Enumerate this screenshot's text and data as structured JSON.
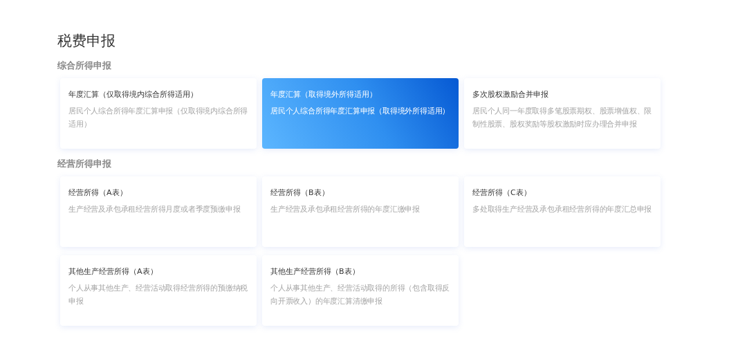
{
  "page_title": "税费申报",
  "sections": [
    {
      "title": "综合所得申报",
      "cards": [
        {
          "title": "年度汇算（仅取得境内综合所得适用）",
          "description": "居民个人综合所得年度汇算申报（仅取得境内综合所得适用）",
          "selected": false
        },
        {
          "title": "年度汇算（取得境外所得适用）",
          "description": "居民个人综合所得年度汇算申报（取得境外所得适用）",
          "selected": true
        },
        {
          "title": "多次股权激励合并申报",
          "description": "居民个人同一年度取得多笔股票期权、股票增值权、限制性股票、股权奖励等股权激励时应办理合并申报",
          "selected": false
        }
      ]
    },
    {
      "title": "经营所得申报",
      "cards": [
        {
          "title": "经营所得（A表）",
          "description": "生产经营及承包承租经营所得月度或者季度预缴申报",
          "selected": false
        },
        {
          "title": "经营所得（B表）",
          "description": "生产经营及承包承租经营所得的年度汇缴申报",
          "selected": false
        },
        {
          "title": "经营所得（C表）",
          "description": "多处取得生产经营及承包承租经营所得的年度汇总申报",
          "selected": false
        },
        {
          "title": "其他生产经营所得（A表）",
          "description": "个人从事其他生产、经营活动取得经营所得的预缴纳税申报",
          "selected": false
        },
        {
          "title": "其他生产经营所得（B表）",
          "description": "个人从事其他生产、经营活动取得的所得（包含取得反向开票收入）的年度汇算清缴申报",
          "selected": false
        }
      ]
    }
  ]
}
